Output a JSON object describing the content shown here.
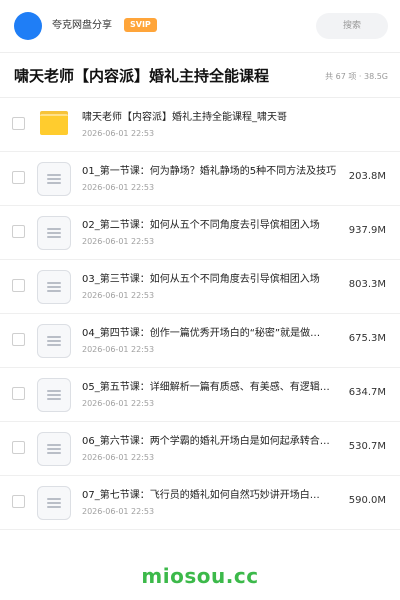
{
  "header": {
    "username": "夸克网盘分享",
    "badge": "SVIP",
    "search_placeholder": "搜索"
  },
  "title_bar": {
    "title": "啸天老师【内容派】婚礼主持全能课程",
    "summary": "共 67 项 · 38.5G"
  },
  "items": [
    {
      "type": "folder",
      "name": "啸天老师【内容派】婚礼主持全能课程_啸天哥",
      "date": "2026-06-01 22:53",
      "size": ""
    },
    {
      "type": "file",
      "name": "01_第一节课：何为静场？婚礼静场的5种不同方法及技巧",
      "date": "2026-06-01 22:53",
      "size": "203.8M"
    },
    {
      "type": "file",
      "name": "02_第二节课：如何从五个不同角度去引导傧相团入场",
      "date": "2026-06-01 22:53",
      "size": "937.9M"
    },
    {
      "type": "file",
      "name": "03_第三节课：如何从五个不同角度去引导傧相团入场",
      "date": "2026-06-01 22:53",
      "size": "803.3M"
    },
    {
      "type": "file",
      "name": "04_第四节课：创作一篇优秀开场白的“秘密”就是做…",
      "date": "2026-06-01 22:53",
      "size": "675.3M"
    },
    {
      "type": "file",
      "name": "05_第五节课：详细解析一篇有质感、有美感、有逻辑…",
      "date": "2026-06-01 22:53",
      "size": "634.7M"
    },
    {
      "type": "file",
      "name": "06_第六节课：两个学霸的婚礼开场白是如何起承转合…",
      "date": "2026-06-01 22:53",
      "size": "530.7M"
    },
    {
      "type": "file",
      "name": "07_第七节课：飞行员的婚礼如何自然巧妙讲开场白…",
      "date": "2026-06-01 22:53",
      "size": "590.0M"
    }
  ],
  "watermark": "miosou.cc",
  "colors": {
    "avatar": "#1f7ef6",
    "badge": "#ffa53a",
    "folder": "#ffcc2e",
    "watermark": "#3cb94a"
  }
}
